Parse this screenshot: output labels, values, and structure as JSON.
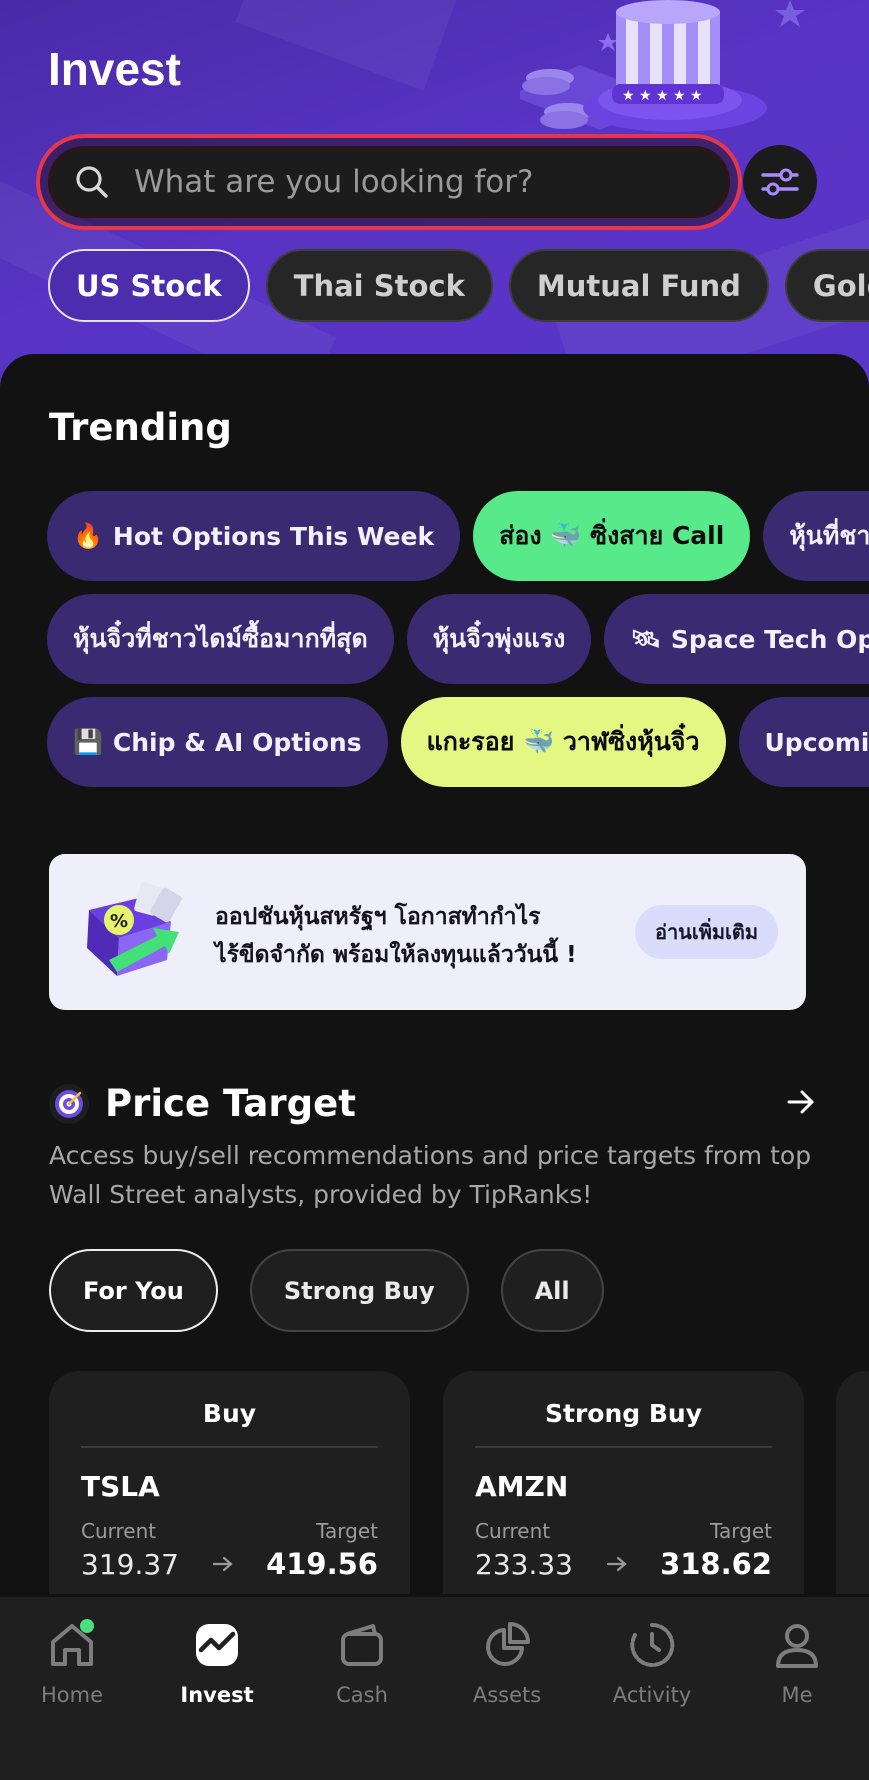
{
  "header": {
    "title": "Invest",
    "search_placeholder": "What are you looking for?",
    "tabs": [
      {
        "label": "US Stock",
        "active": true
      },
      {
        "label": "Thai Stock",
        "active": false
      },
      {
        "label": "Mutual Fund",
        "active": false
      },
      {
        "label": "Gold",
        "active": false
      }
    ]
  },
  "trending": {
    "title": "Trending",
    "rows": [
      [
        {
          "emoji": "🔥",
          "label": "Hot Options This Week",
          "style": "purple"
        },
        {
          "label": "ส่อง 🐳 ซิ่งสาย Call",
          "style": "green"
        },
        {
          "label": "หุ้นที่ชาวไดม",
          "style": "purple"
        }
      ],
      [
        {
          "label": "หุ้นจิ๋วที่ชาวไดม์ซื้อมากที่สุด",
          "style": "purple"
        },
        {
          "label": "หุ้นจิ๋วพุ่งแรง",
          "style": "purple"
        },
        {
          "emoji": "🛰",
          "label": "Space Tech Optio",
          "style": "purple"
        }
      ],
      [
        {
          "emoji": "💾",
          "label": "Chip & AI Options",
          "style": "purple"
        },
        {
          "label": "แกะรอย 🐳 วาฬซิ่งหุ้นจิ๋ว",
          "style": "lime"
        },
        {
          "label": "Upcoming X",
          "style": "purple"
        }
      ]
    ]
  },
  "banner": {
    "line1": "ออปชันหุ้นสหรัฐฯ โอกาสทำกำไร",
    "line2": "ไร้ขีดจำกัด พร้อมให้ลงทุนแล้ววันนี้ !",
    "button": "อ่านเพิ่มเติม"
  },
  "price_target": {
    "title": "Price Target",
    "description": "Access buy/sell recommendations and price targets from top Wall Street analysts, provided by TipRanks!",
    "filters": [
      {
        "label": "For You",
        "active": true
      },
      {
        "label": "Strong Buy",
        "active": false
      },
      {
        "label": "All",
        "active": false
      }
    ],
    "cards": [
      {
        "rating": "Buy",
        "ticker": "TSLA",
        "current_label": "Current",
        "target_label": "Target",
        "current": "319.37",
        "target": "419.56"
      },
      {
        "rating": "Strong Buy",
        "ticker": "AMZN",
        "current_label": "Current",
        "target_label": "Target",
        "current": "233.33",
        "target": "318.62"
      }
    ]
  },
  "bottom_nav": [
    {
      "label": "Home",
      "icon": "home-icon",
      "active": false,
      "badge": true
    },
    {
      "label": "Invest",
      "icon": "invest-icon",
      "active": true
    },
    {
      "label": "Cash",
      "icon": "wallet-icon",
      "active": false
    },
    {
      "label": "Assets",
      "icon": "pie-chart-icon",
      "active": false
    },
    {
      "label": "Activity",
      "icon": "clock-icon",
      "active": false
    },
    {
      "label": "Me",
      "icon": "user-icon",
      "active": false
    }
  ],
  "colors": {
    "header_purple": "#5833c4",
    "search_highlight": "#e6364c",
    "chip_purple": "#3a2a72",
    "chip_green": "#57e98a",
    "chip_lime": "#e3f782",
    "badge_green": "#49e07f"
  }
}
